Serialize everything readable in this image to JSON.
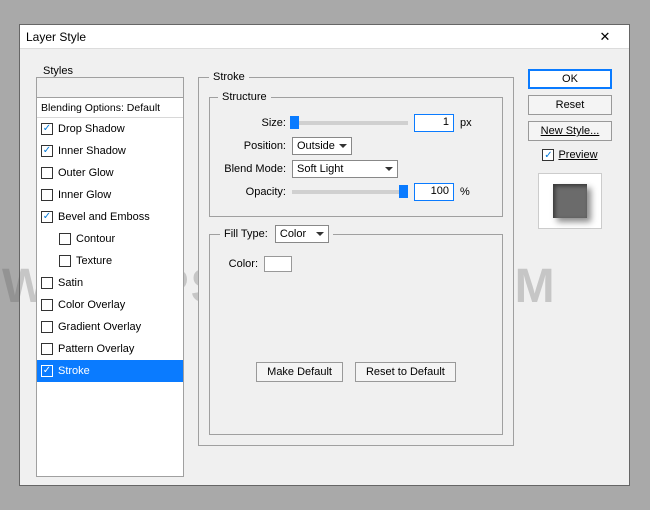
{
  "window": {
    "title": "Layer Style"
  },
  "watermark": "WWW.PSD-DUDE.COM",
  "styles_panel": {
    "header": "Styles",
    "blending": "Blending Options: Default",
    "items": [
      {
        "label": "Drop Shadow",
        "checked": true,
        "indent": false,
        "selected": false
      },
      {
        "label": "Inner Shadow",
        "checked": true,
        "indent": false,
        "selected": false
      },
      {
        "label": "Outer Glow",
        "checked": false,
        "indent": false,
        "selected": false
      },
      {
        "label": "Inner Glow",
        "checked": false,
        "indent": false,
        "selected": false
      },
      {
        "label": "Bevel and Emboss",
        "checked": true,
        "indent": false,
        "selected": false
      },
      {
        "label": "Contour",
        "checked": false,
        "indent": true,
        "selected": false
      },
      {
        "label": "Texture",
        "checked": false,
        "indent": true,
        "selected": false
      },
      {
        "label": "Satin",
        "checked": false,
        "indent": false,
        "selected": false
      },
      {
        "label": "Color Overlay",
        "checked": false,
        "indent": false,
        "selected": false
      },
      {
        "label": "Gradient Overlay",
        "checked": false,
        "indent": false,
        "selected": false
      },
      {
        "label": "Pattern Overlay",
        "checked": false,
        "indent": false,
        "selected": false
      },
      {
        "label": "Stroke",
        "checked": true,
        "indent": false,
        "selected": true
      }
    ]
  },
  "stroke": {
    "group_label": "Stroke",
    "structure_label": "Structure",
    "size_label": "Size:",
    "size_value": "1",
    "size_unit": "px",
    "position_label": "Position:",
    "position_value": "Outside",
    "blendmode_label": "Blend Mode:",
    "blendmode_value": "Soft Light",
    "opacity_label": "Opacity:",
    "opacity_value": "100",
    "opacity_unit": "%",
    "filltype_label": "Fill Type:",
    "filltype_value": "Color",
    "color_label": "Color:",
    "make_default": "Make Default",
    "reset_default": "Reset to Default"
  },
  "right": {
    "ok": "OK",
    "reset": "Reset",
    "new_style": "New Style...",
    "preview_label": "Preview",
    "preview_checked": true
  }
}
